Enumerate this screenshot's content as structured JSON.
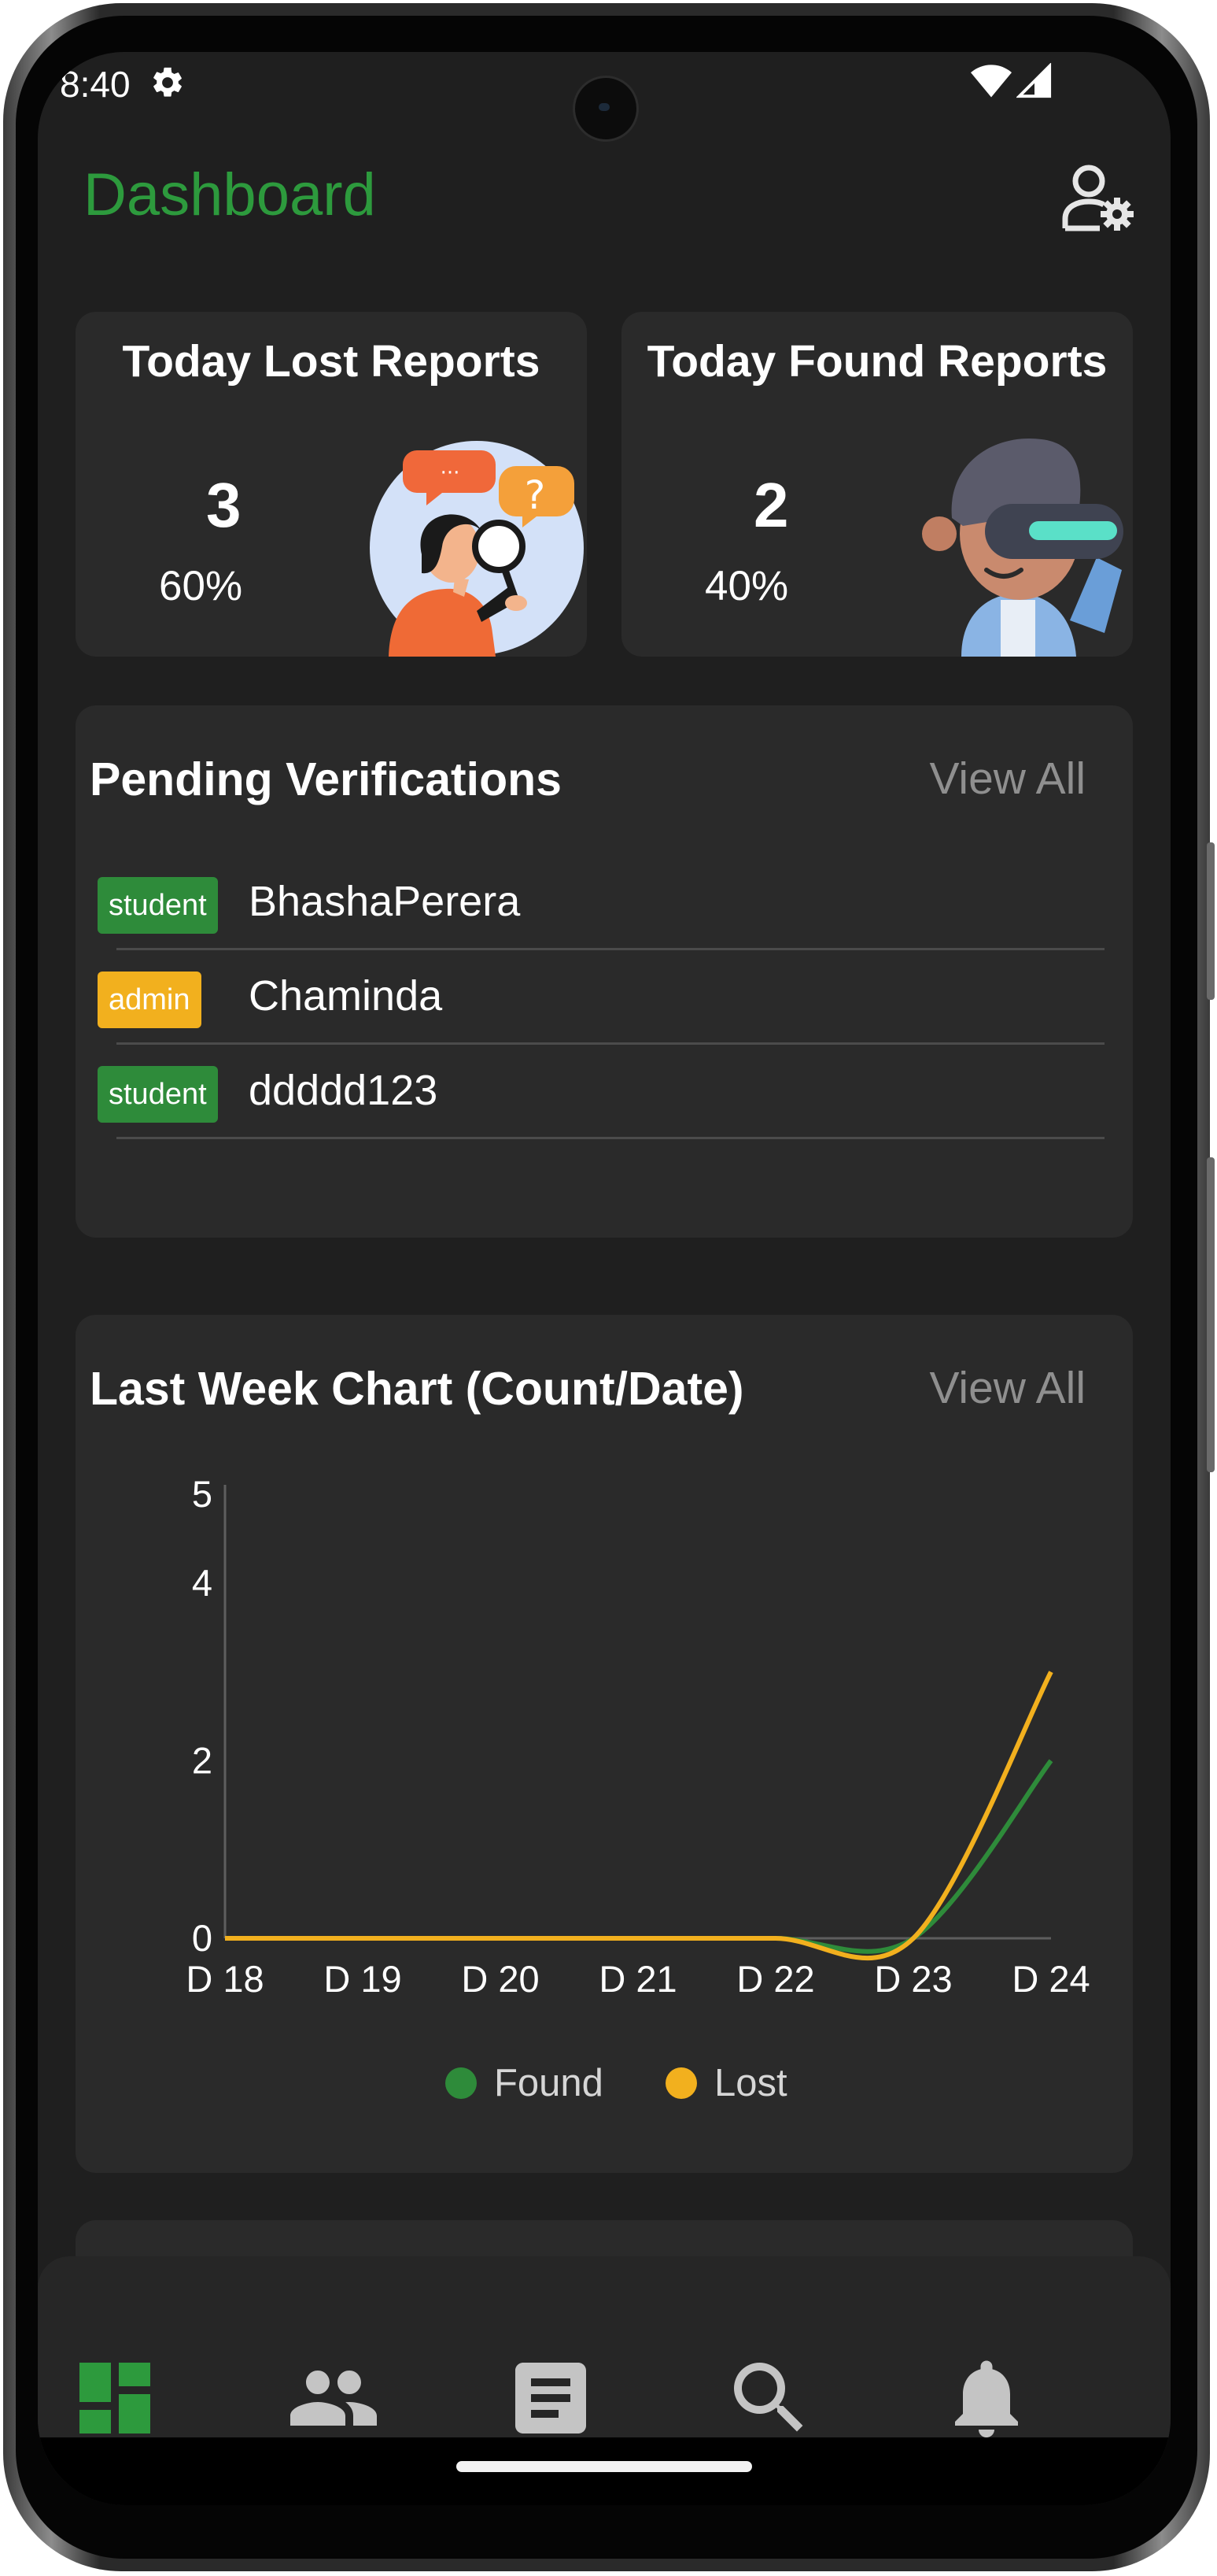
{
  "status_bar": {
    "time": "8:40"
  },
  "header": {
    "title": "Dashboard"
  },
  "stats": {
    "lost": {
      "title": "Today Lost Reports",
      "count": "3",
      "percent": "60%"
    },
    "found": {
      "title": "Today Found Reports",
      "count": "2",
      "percent": "40%"
    }
  },
  "pending": {
    "title": "Pending Verifications",
    "view_all": "View All",
    "items": [
      {
        "role": "student",
        "name": "BhashaPerera"
      },
      {
        "role": "admin",
        "name": "Chaminda"
      },
      {
        "role": "student",
        "name": "ddddd123"
      }
    ]
  },
  "chart_section": {
    "title": "Last Week Chart (Count/Date)",
    "view_all": "View All"
  },
  "chart_data": {
    "type": "line",
    "title": "Last Week Chart (Count/Date)",
    "x": [
      "D 18",
      "D 19",
      "D 20",
      "D 21",
      "D 22",
      "D 23",
      "D 24"
    ],
    "y_ticks": [
      "0",
      "2",
      "4",
      "5"
    ],
    "ylim": [
      0,
      5
    ],
    "series": [
      {
        "name": "Found",
        "color": "#2e8b3a",
        "values": [
          0,
          0,
          0,
          0,
          0,
          0,
          2
        ]
      },
      {
        "name": "Lost",
        "color": "#f2b01e",
        "values": [
          0,
          0,
          0,
          0,
          0,
          0,
          3
        ]
      }
    ],
    "legend_position": "bottom",
    "grid": false
  },
  "colors": {
    "accent": "#2d9a3d",
    "student_badge": "#2e8b3a",
    "admin_badge": "#f2b01e"
  },
  "bottom_nav": {
    "items": [
      {
        "icon": "dashboard-icon",
        "active": true
      },
      {
        "icon": "people-icon",
        "active": false
      },
      {
        "icon": "article-icon",
        "active": false
      },
      {
        "icon": "search-icon",
        "active": false
      },
      {
        "icon": "notifications-icon",
        "active": false
      }
    ]
  }
}
